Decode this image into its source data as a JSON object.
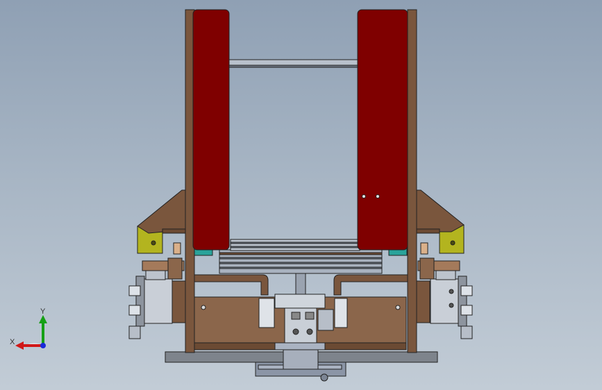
{
  "viewport": {
    "background_top": "#8fa0b4",
    "background_bottom": "#c2ccd6"
  },
  "triad": {
    "x_label": "X",
    "y_label": "Y",
    "x_color": "#d01818",
    "y_color": "#16a016",
    "z_color": "#1a2bd8"
  },
  "colors": {
    "red_panel": "#7f0000",
    "brown_frame": "#7a563d",
    "brown_plate": "#8b664b",
    "olive_bracket": "#b3b41f",
    "steel": "#c9cfd7",
    "dark_steel": "#4a4f57",
    "base_plate": "#7e848c",
    "teal_spacer": "#2aa39a"
  }
}
